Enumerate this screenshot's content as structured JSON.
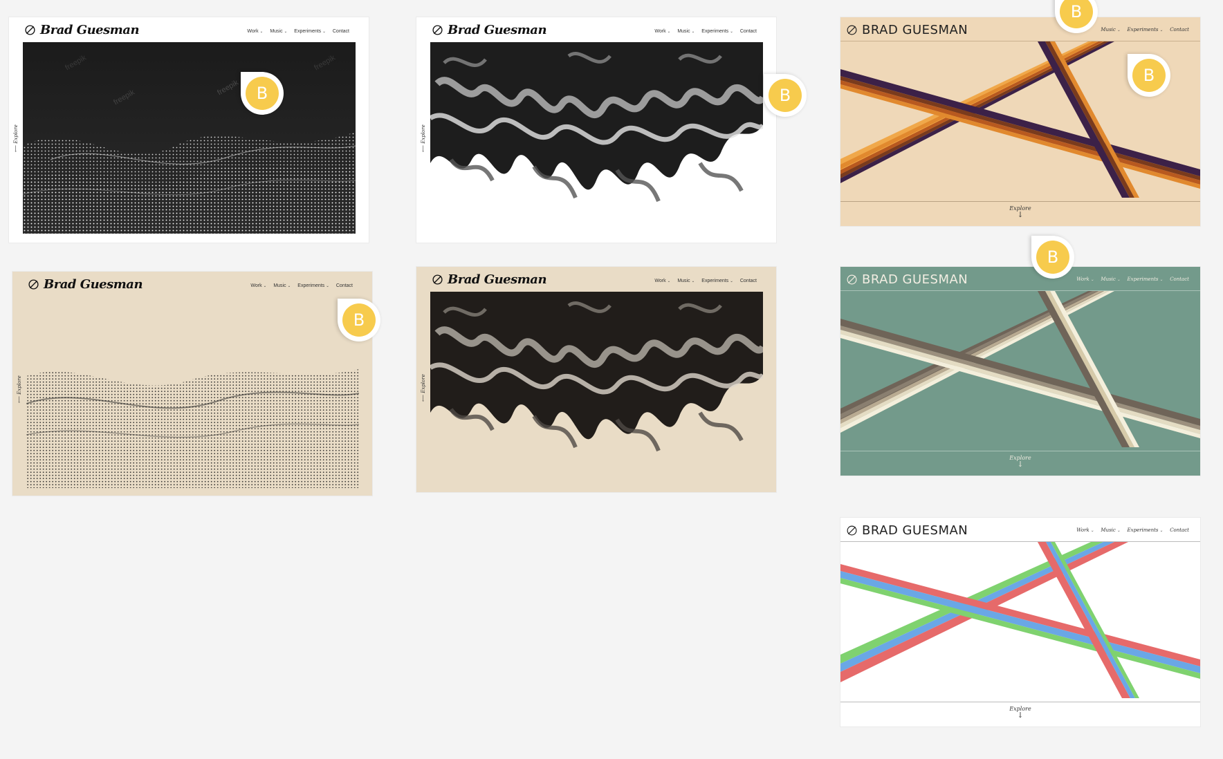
{
  "brand_serif": "Brad Guesman",
  "brand_caps": "BRAD GUESMAN",
  "nav": {
    "work": "Work",
    "music": "Music",
    "experiments": "Experiments",
    "contact": "Contact"
  },
  "nav_chevron": "⌄",
  "explore_label": "Explore",
  "side_explore_label": "⟵ Explore",
  "explore_arrow": "↓",
  "watermark": "freepik",
  "avatar_initial": "B",
  "colors": {
    "canvas_bg": "#f4f4f4",
    "beige": "#e9dcc6",
    "peach": "#efd8b8",
    "teal": "#739a8b",
    "avatar_yellow": "#f7cb4d",
    "stripe_purple": "#3c2148",
    "stripe_brown": "#7a3b1d",
    "stripe_orange": "#e1892e",
    "stripe_gold": "#f0a84a",
    "stripe_green": "#7fd26f",
    "stripe_blue": "#6aa7e6",
    "stripe_red": "#e66a6a"
  },
  "cards": [
    {
      "id": "wave-dark",
      "theme": "serif",
      "background": "white",
      "artwork": "dark dotted wave"
    },
    {
      "id": "ink-dark",
      "theme": "serif",
      "background": "white",
      "artwork": "black ink marbling"
    },
    {
      "id": "stripes-peach",
      "theme": "caps",
      "background": "peach",
      "artwork": "retro stripes"
    },
    {
      "id": "wave-beige",
      "theme": "serif",
      "background": "beige",
      "artwork": "beige dotted wave"
    },
    {
      "id": "ink-beige",
      "theme": "serif",
      "background": "beige",
      "artwork": "ink marbling on beige"
    },
    {
      "id": "stripes-teal",
      "theme": "caps",
      "background": "teal",
      "artwork": "cream stripes"
    },
    {
      "id": "stripes-white",
      "theme": "caps",
      "background": "white",
      "artwork": "rainbow stripes"
    }
  ]
}
